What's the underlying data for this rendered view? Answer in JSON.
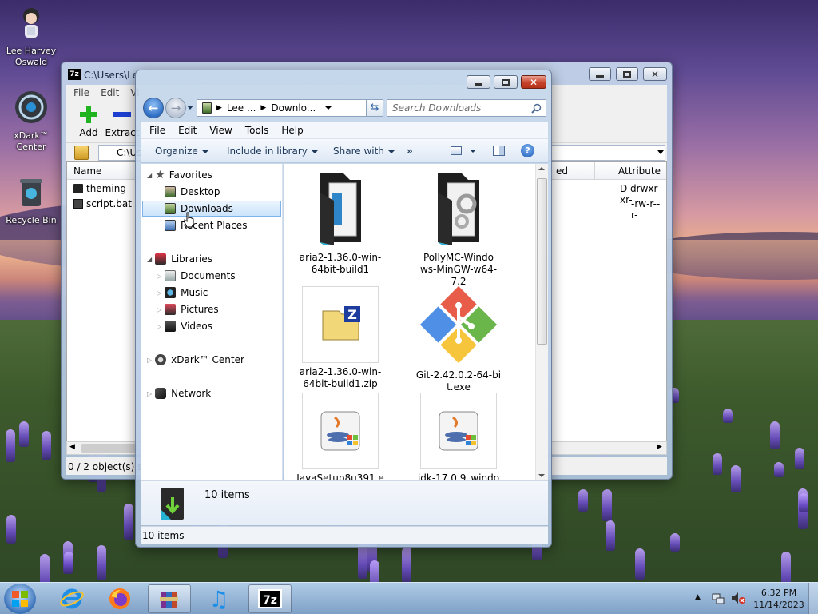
{
  "desktop": {
    "icons": [
      {
        "label": "Lee Harvey Oswald"
      },
      {
        "label": "xDark™ Center"
      },
      {
        "label": "Recycle Bin"
      }
    ]
  },
  "zip_window": {
    "title": "C:\\Users\\Le",
    "menu": [
      "File",
      "Edit",
      "Vi"
    ],
    "toolbar": {
      "add": "Add",
      "extract": "Extract"
    },
    "path": "C:\\Us",
    "columns": {
      "name": "Name",
      "modified": "ed",
      "attributes": "Attribute"
    },
    "rows": [
      {
        "name": "theming",
        "attributes": "D drwxr-xr-"
      },
      {
        "name": "script.bat",
        "attributes": "-rw-r--r-"
      }
    ],
    "status": "0 / 2 object(s) se"
  },
  "explorer": {
    "breadcrumb": [
      "Lee ...",
      "Downlo..."
    ],
    "search_placeholder": "Search Downloads",
    "menu": [
      "File",
      "Edit",
      "View",
      "Tools",
      "Help"
    ],
    "commands": {
      "organize": "Organize",
      "include": "Include in library",
      "share": "Share with",
      "more": "»"
    },
    "nav": {
      "favorites": "Favorites",
      "desktop": "Desktop",
      "downloads": "Downloads",
      "recent": "Recent Places",
      "libraries": "Libraries",
      "documents": "Documents",
      "music": "Music",
      "pictures": "Pictures",
      "videos": "Videos",
      "xdark": "xDark™ Center",
      "network": "Network"
    },
    "files": [
      {
        "line1": "aria2-1.36.0-win-",
        "line2": "64bit-build1",
        "line3": ""
      },
      {
        "line1": "PollyMC-Windo",
        "line2": "ws-MinGW-w64-",
        "line3": "7.2"
      },
      {
        "line1": "aria2-1.36.0-win-",
        "line2": "64bit-build1.zip",
        "line3": ""
      },
      {
        "line1": "Git-2.42.0.2-64-bi",
        "line2": "t.exe",
        "line3": ""
      },
      {
        "line1": "JavaSetup8u391.e",
        "line2": "",
        "line3": ""
      },
      {
        "line1": "jdk-17.0.9_windo",
        "line2": "",
        "line3": ""
      }
    ],
    "details_count": "10 items",
    "status": "10 items"
  },
  "taskbar": {
    "time": "6:32 PM",
    "date": "11/14/2023"
  }
}
